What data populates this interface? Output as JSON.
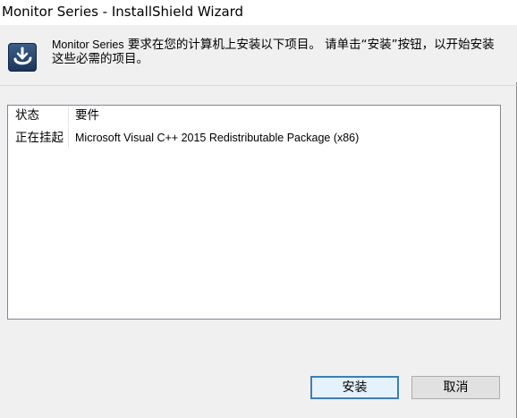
{
  "window": {
    "title": "Monitor Series - InstallShield Wizard"
  },
  "header": {
    "product_name": "Monitor Series",
    "message": " 要求在您的计算机上安装以下项目。 请单击“安装”按钮，以开始安装这些必需的项目。",
    "logo_icon": "installshield-icon"
  },
  "requirements_list": {
    "columns": [
      "状态",
      "要件"
    ],
    "rows": [
      {
        "status": "正在挂起",
        "requirement": "Microsoft Visual C++ 2015 Redistributable Package (x86)"
      }
    ]
  },
  "buttons": {
    "install_label": "安装",
    "cancel_label": "取消"
  },
  "colors": {
    "window_bg": "#f0f0f0",
    "titlebar_bg": "#ffffff",
    "list_bg": "#ffffff",
    "default_button_border": "#3c7fb1"
  }
}
